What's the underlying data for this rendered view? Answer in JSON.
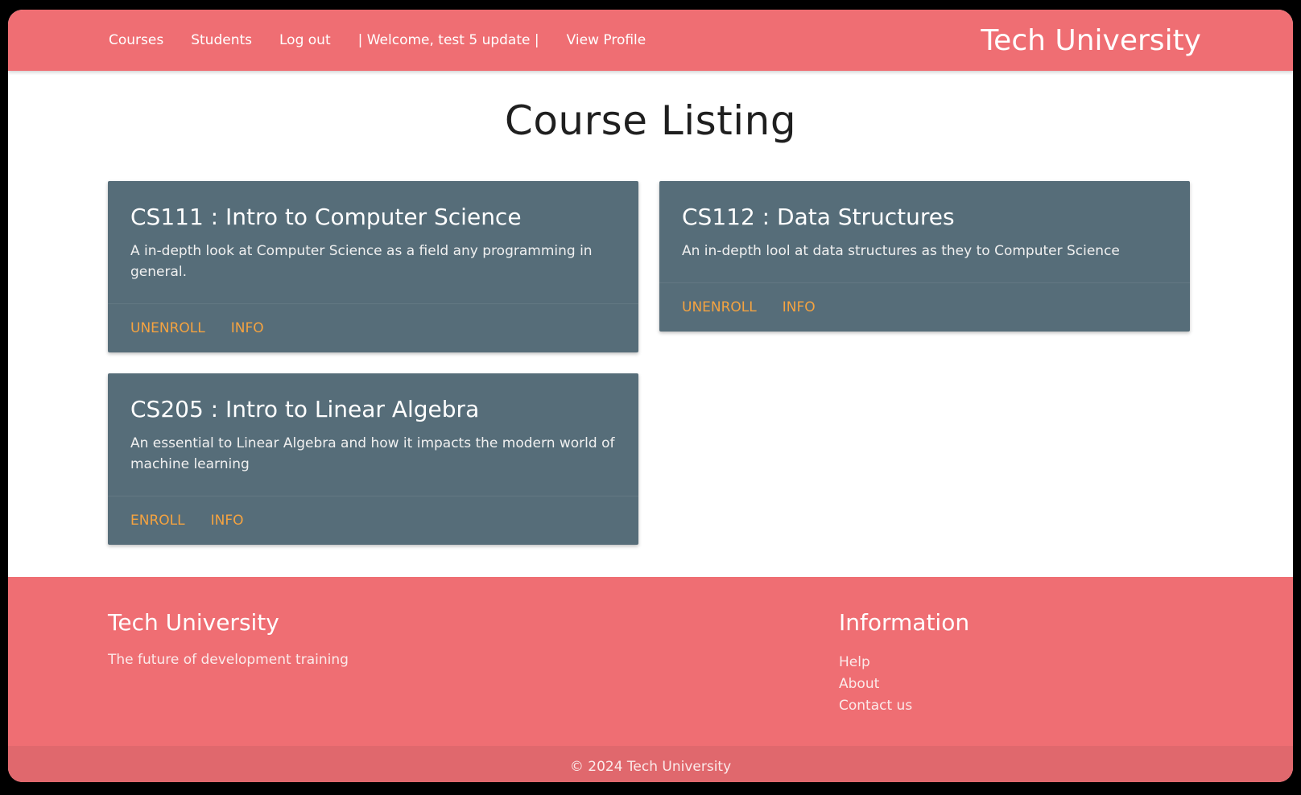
{
  "colors": {
    "primary": "#ef6e73",
    "card_bg": "#566d79",
    "action_link": "#f5a340",
    "copyright_bg": "#e0686d"
  },
  "nav": {
    "links": {
      "courses": "Courses",
      "students": "Students",
      "logout": "Log out",
      "welcome": "| Welcome, test 5 update |",
      "view_profile": "View Profile"
    },
    "brand": "Tech University"
  },
  "main": {
    "title": "Course Listing",
    "courses": [
      {
        "title": "CS111 : Intro to Computer Science",
        "description": "A in-depth look at Computer Science as a field any programming in general.",
        "primary_action": "UNENROLL",
        "info_action": "INFO"
      },
      {
        "title": "CS112 : Data Structures",
        "description": "An in-depth lool at data structures as they to Computer Science",
        "primary_action": "UNENROLL",
        "info_action": "INFO"
      },
      {
        "title": "CS205 : Intro to Linear Algebra",
        "description": "An essential to Linear Algebra and how it impacts the modern world of machine learning",
        "primary_action": "ENROLL",
        "info_action": "INFO"
      }
    ]
  },
  "footer": {
    "brand_heading": "Tech University",
    "tagline": "The future of development training",
    "info_heading": "Information",
    "links": {
      "help": "Help",
      "about": "About",
      "contact": "Contact us"
    },
    "copyright": "© 2024 Tech University"
  }
}
